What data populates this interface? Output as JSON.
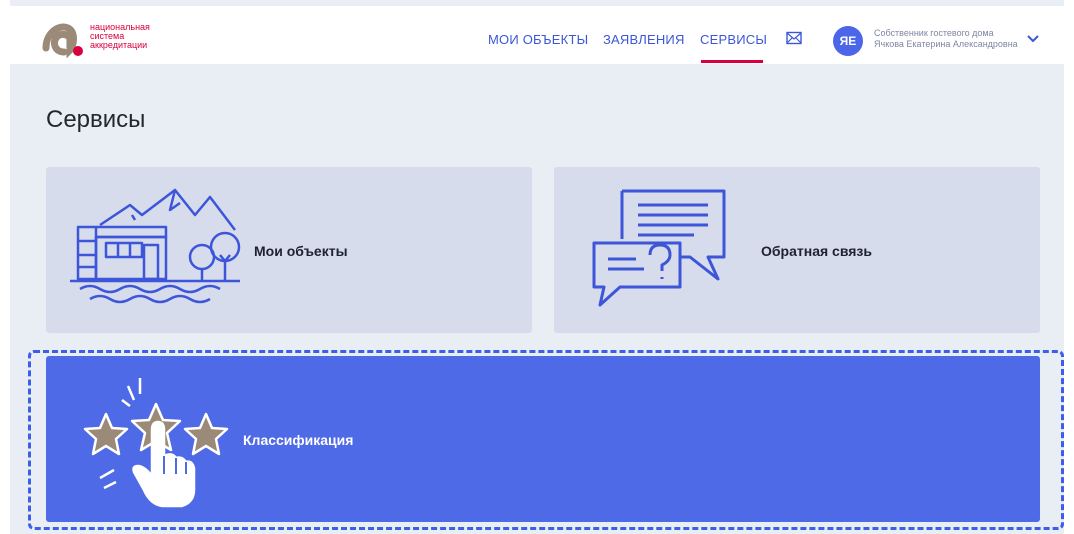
{
  "brand": {
    "logo_lines": [
      "национальная",
      "система",
      "аккредитации"
    ]
  },
  "nav": {
    "items": [
      {
        "label": "МОИ ОБЪЕКТЫ"
      },
      {
        "label": "ЗАЯВЛЕНИЯ"
      },
      {
        "label": "СЕРВИСЫ",
        "active": true
      }
    ],
    "mail_icon": "envelope-icon"
  },
  "user": {
    "initials": "ЯЕ",
    "role": "Собственник гостевого дома",
    "name": "Ячкова Екатерина Александровна"
  },
  "page": {
    "title": "Сервисы"
  },
  "cards": [
    {
      "label": "Мои объекты",
      "icon": "house-landscape-icon"
    },
    {
      "label": "Обратная связь",
      "icon": "chat-question-icon"
    },
    {
      "label": "Классификация",
      "icon": "stars-rating-icon",
      "highlighted": true
    }
  ],
  "colors": {
    "accent": "#4f6ae6",
    "brand_red": "#d9003f",
    "card_bg": "#d6dceb",
    "page_bg": "#e9edf4"
  }
}
